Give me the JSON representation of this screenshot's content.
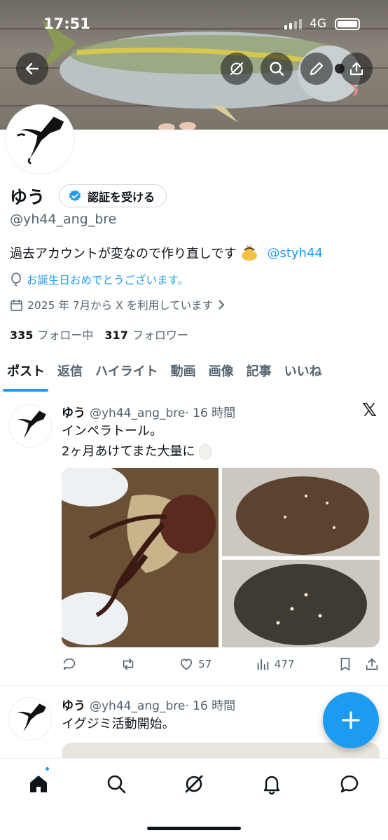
{
  "status_bar": {
    "time": "17:51",
    "network": "4G"
  },
  "profile": {
    "name": "ゆう",
    "verify_label": "認証を受ける",
    "handle": "@yh44_ang_bre",
    "bio": "過去アカウントが変なので作り直しです",
    "bio_mention": "@styh44",
    "birthday": "お誕生日おめでとうございます。",
    "joined": "2025 年 7月から X を利用しています",
    "following_count": "335",
    "following_label": "フォロー中",
    "followers_count": "317",
    "followers_label": "フォロワー"
  },
  "tabs": [
    "ポスト",
    "返信",
    "ハイライト",
    "動画",
    "画像",
    "記事",
    "いいね"
  ],
  "posts": [
    {
      "name": "ゆう",
      "handle": "@yh44_ang_bre",
      "time": "· 16 時間",
      "text_line1": "インペラトール。",
      "text_line2": "2ヶ月あけてまた大量に",
      "likes": "57",
      "views": "477"
    },
    {
      "name": "ゆう",
      "handle": "@yh44_ang_bre",
      "time": "· 16 時間",
      "text_line1": "イグジミ活動開始。"
    }
  ],
  "icons": [
    "back-arrow-icon",
    "grok-icon",
    "search-icon",
    "edit-icon",
    "share-icon",
    "verified-badge-icon",
    "balloon-icon",
    "calendar-icon",
    "chevron-right-icon",
    "x-logo-icon",
    "reply-icon",
    "repost-icon",
    "like-icon",
    "views-icon",
    "bookmark-icon",
    "home-icon",
    "notifications-icon",
    "messages-icon",
    "compose-plus-icon"
  ],
  "colors": {
    "accent": "#1d9bf0",
    "text": "#0f1419",
    "secondary": "#536471"
  }
}
